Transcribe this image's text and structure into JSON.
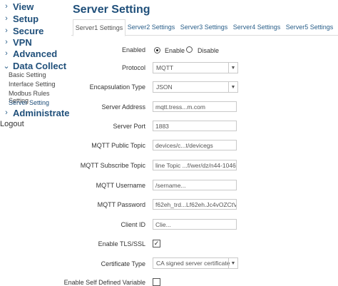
{
  "sidebar": {
    "top_items": [
      {
        "label": "View"
      },
      {
        "label": "Setup"
      },
      {
        "label": "Secure"
      },
      {
        "label": "VPN"
      },
      {
        "label": "Advanced"
      },
      {
        "label": "Data Collect"
      }
    ],
    "sub_items": [
      {
        "label": "Basic Setting"
      },
      {
        "label": "Interface Setting"
      },
      {
        "label": "Modbus Rules Setting"
      },
      {
        "label": "Server Setting"
      }
    ],
    "admin_label": "Administrate",
    "logout_label": "Logout",
    "active_sub": "Server Setting"
  },
  "page": {
    "title": "Server Setting"
  },
  "tabs": [
    {
      "label": "Server1 Settings"
    },
    {
      "label": "Server2 Settings"
    },
    {
      "label": "Server3 Settings"
    },
    {
      "label": "Server4 Settings"
    },
    {
      "label": "Server5 Settings"
    }
  ],
  "active_tab": "Server1 Settings",
  "form": {
    "enabled": {
      "label": "Enabled",
      "enable_label": "Enable",
      "disable_label": "Disable",
      "selected": "Enable"
    },
    "protocol": {
      "label": "Protocol",
      "value": "MQTT"
    },
    "encapsulation": {
      "label": "Encapsulation Type",
      "value": "JSON"
    },
    "server_address": {
      "label": "Server Address",
      "value": "mqtt.tress...m.com"
    },
    "server_port": {
      "label": "Server Port",
      "value": "1883"
    },
    "public_topic": {
      "label": "MQTT Public Topic",
      "value": "devices/c...t/devicegs"
    },
    "subscribe_topic": {
      "label": "MQTT Subscribe Topic",
      "value": "line Topic ...f/wer/dz/n44-1046/"
    },
    "username": {
      "label": "MQTT Username",
      "value": "/sername..."
    },
    "password": {
      "label": "MQTT Password",
      "value": "f62eh_trd...Lf62eh.Jc4vOZCtVvt"
    },
    "client_id": {
      "label": "Client ID",
      "value": "Clie..."
    },
    "tls": {
      "label": "Enable TLS/SSL",
      "checked": true
    },
    "certificate": {
      "label": "Certificate Type",
      "value": "CA signed server certificate"
    },
    "self_defined": {
      "label": "Enable Self Defined Variable",
      "checked": false
    }
  }
}
